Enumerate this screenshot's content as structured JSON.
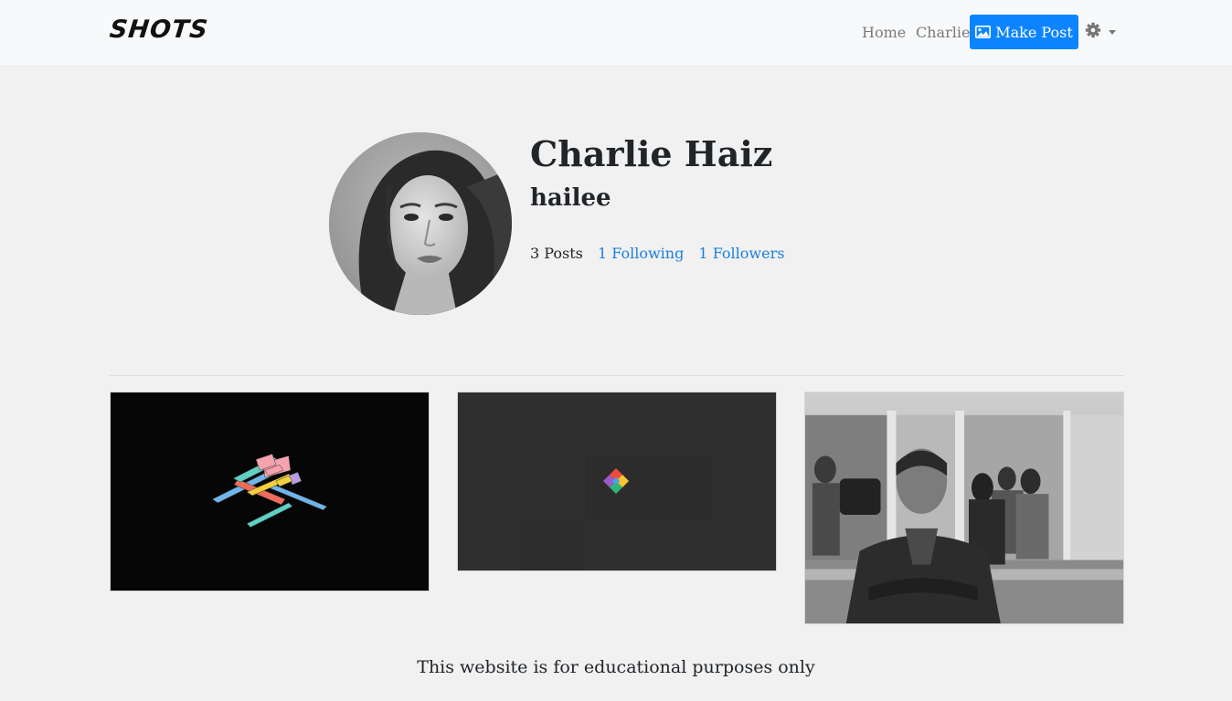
{
  "brand": "SHOTS",
  "nav": {
    "home": "Home",
    "user": "Charlie",
    "make_post": "Make Post"
  },
  "icons": {
    "make_post": "image-icon",
    "settings": "gear-icon",
    "settings_caret": "caret-down-icon"
  },
  "colors": {
    "primary": "#0d84ff",
    "link": "#1a7fe0",
    "navbar_bg": "#f8f9fa",
    "page_bg": "#f1f1f1"
  },
  "profile": {
    "name": "Charlie Haiz",
    "username": "hailee",
    "posts": "3 Posts",
    "following": "1 Following",
    "followers": "1 Followers"
  },
  "posts": [
    {
      "name": "post-isometric-blocks"
    },
    {
      "name": "post-color-diamond"
    },
    {
      "name": "post-bw-photo"
    }
  ],
  "footer": "This website is for educational purposes only"
}
